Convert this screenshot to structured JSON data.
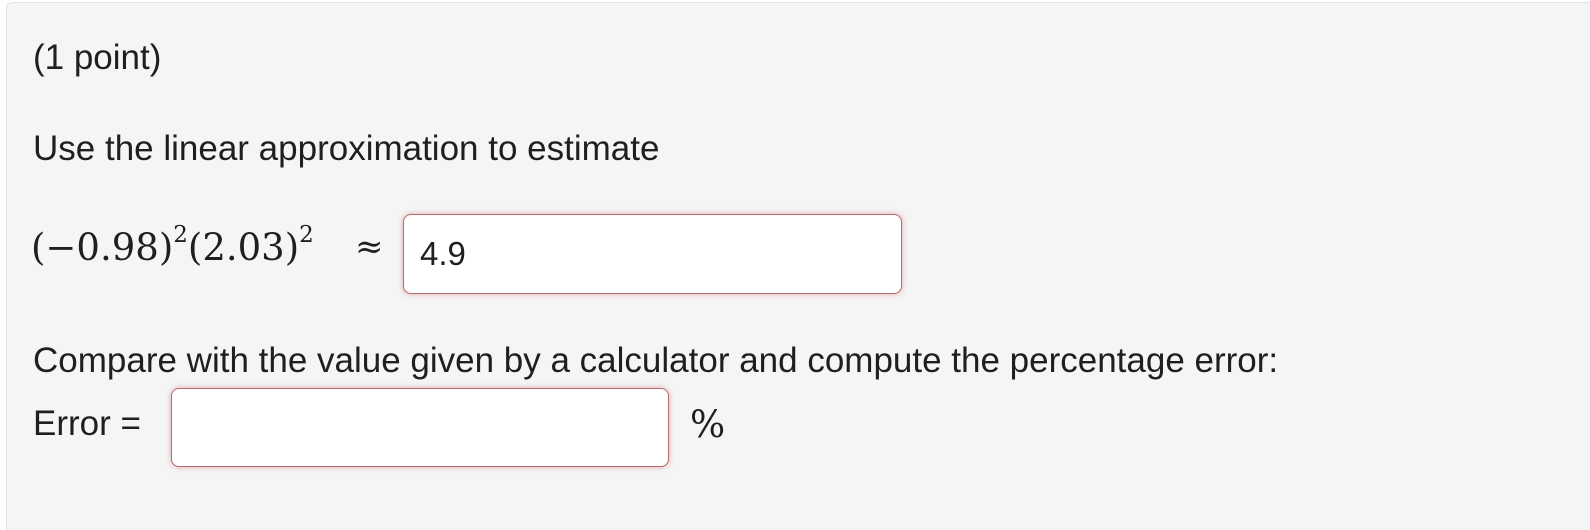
{
  "problem": {
    "points": "(1 point)",
    "prompt": "Use the linear approximation to estimate",
    "expression": {
      "term1": "(−0.98)",
      "exp1": "2",
      "term2": "(2.03)",
      "exp2": "2",
      "approx_symbol": "≈"
    },
    "answer1": {
      "value": "4.9"
    },
    "compare_text": "Compare with the value given by a calculator and compute the percentage error:",
    "error_label": "Error =",
    "answer2": {
      "value": ""
    },
    "percent_symbol": "%"
  },
  "colors": {
    "panel_background": "#f5f5f5",
    "input_border": "#b86a6a",
    "text": "#1f1f1f"
  }
}
